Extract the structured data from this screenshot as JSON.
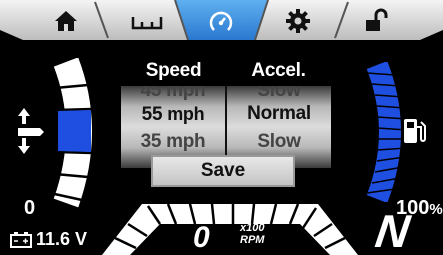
{
  "tabs": [
    {
      "icon": "home-icon"
    },
    {
      "icon": "trim-gauge-icon"
    },
    {
      "icon": "speedometer-icon",
      "active": true
    },
    {
      "icon": "gear-icon"
    },
    {
      "icon": "unlock-icon"
    }
  ],
  "picker": {
    "speed": {
      "label": "Speed",
      "above": "45 mph",
      "selected_value": "55",
      "selected_unit": "mph",
      "below": "35 mph"
    },
    "accel": {
      "label": "Accel.",
      "above": "Slow",
      "selected": "Normal",
      "below": "Slow"
    }
  },
  "save_label": "Save",
  "trim": {
    "value": "0"
  },
  "fuel": {
    "value": "100",
    "unit": "%",
    "level": 1.0
  },
  "battery": {
    "value": "11.6 V"
  },
  "rpm": {
    "value": "0",
    "unit_top": "x100",
    "unit_bottom": "RPM"
  },
  "gear": {
    "value": "N"
  },
  "colors": {
    "accent": "#1f4fe0",
    "active_tab": "#3a8ee0"
  }
}
